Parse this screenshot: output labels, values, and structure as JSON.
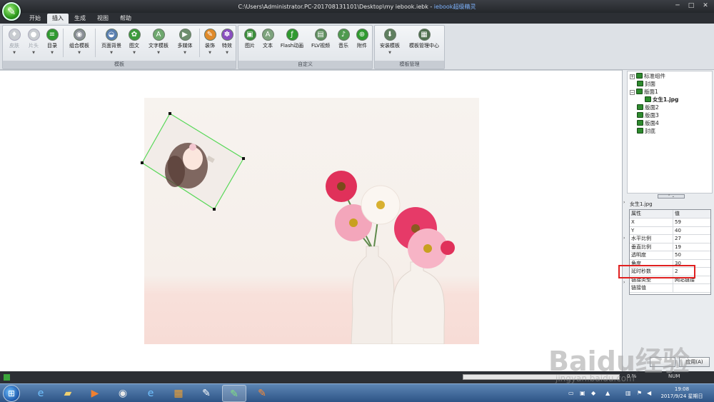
{
  "window": {
    "path": "C:\\Users\\Administrator.PC-201708131101\\Desktop\\my iebook.iebk - ",
    "app_name": "iebook超级精灵",
    "min_icon": "minimize-icon",
    "max_icon": "maximize-icon",
    "close_icon": "close-icon"
  },
  "tabs": [
    "开始",
    "插入",
    "生成",
    "视图",
    "帮助"
  ],
  "active_tab": "插入",
  "ribbon": {
    "groups": [
      {
        "label": "模板",
        "buttons": [
          {
            "label": "皮肤",
            "icon": "skin-icon",
            "enabled": false
          },
          {
            "label": "片头",
            "icon": "intro-icon",
            "enabled": false
          },
          {
            "label": "目录",
            "icon": "catalog-icon",
            "enabled": true
          },
          {
            "label": "组合模板",
            "icon": "combined-template-icon",
            "enabled": true
          },
          {
            "label": "页面背景",
            "icon": "page-background-icon",
            "enabled": true
          },
          {
            "label": "图文",
            "icon": "image-text-icon",
            "enabled": true
          },
          {
            "label": "文字模板",
            "icon": "text-template-icon",
            "enabled": true
          },
          {
            "label": "多媒体",
            "icon": "multimedia-icon",
            "enabled": true
          },
          {
            "label": "装饰",
            "icon": "decoration-icon",
            "enabled": true
          },
          {
            "label": "特效",
            "icon": "effects-icon",
            "enabled": true
          }
        ]
      },
      {
        "label": "自定义",
        "buttons": [
          {
            "label": "图片",
            "icon": "picture-icon",
            "enabled": true
          },
          {
            "label": "文本",
            "icon": "text-icon",
            "enabled": true
          },
          {
            "label": "Flash动画",
            "icon": "flash-icon",
            "enabled": true
          },
          {
            "label": "FLV视频",
            "icon": "flv-video-icon",
            "enabled": true
          },
          {
            "label": "音乐",
            "icon": "music-icon",
            "enabled": true
          },
          {
            "label": "附件",
            "icon": "attachment-icon",
            "enabled": true
          }
        ]
      },
      {
        "label": "模板管理",
        "buttons": [
          {
            "label": "安装模板",
            "icon": "install-template-icon",
            "enabled": true
          },
          {
            "label": "模板管理中心",
            "icon": "template-manager-icon",
            "enabled": true
          }
        ]
      }
    ]
  },
  "tree": [
    {
      "label": "标准组件",
      "level": 0,
      "expander": "+",
      "bold": false
    },
    {
      "label": "封面",
      "level": 0,
      "expander": "",
      "bold": false
    },
    {
      "label": "版面1",
      "level": 0,
      "expander": "−",
      "bold": false
    },
    {
      "label": "女生1.jpg",
      "level": 1,
      "expander": "",
      "bold": true
    },
    {
      "label": "版面2",
      "level": 0,
      "expander": "",
      "bold": false
    },
    {
      "label": "版面3",
      "level": 0,
      "expander": "",
      "bold": false
    },
    {
      "label": "版面4",
      "level": 0,
      "expander": "",
      "bold": false
    },
    {
      "label": "封底",
      "level": 0,
      "expander": "",
      "bold": false
    }
  ],
  "props": {
    "title": "女生1.jpg",
    "header": {
      "key": "属性",
      "value": "值"
    },
    "rows": [
      {
        "key": "X",
        "value": "59"
      },
      {
        "key": "Y",
        "value": "40"
      },
      {
        "key": "水平比例",
        "value": "27"
      },
      {
        "key": "垂直比例",
        "value": "19"
      },
      {
        "key": "透明度",
        "value": "50"
      },
      {
        "key": "角度",
        "value": "30"
      },
      {
        "key": "延时秒数",
        "value": "2"
      },
      {
        "key": "链接类型",
        "value": "网站链接"
      },
      {
        "key": "链接值",
        "value": ""
      }
    ],
    "buttons": [
      "",
      "应用(A)"
    ]
  },
  "statusbar": {
    "zoom": "0 %",
    "num": "NUM"
  },
  "taskbar": {
    "icons": [
      "start-orb-icon",
      "ie-icon",
      "folder-icon",
      "media-player-icon",
      "chrome-icon",
      "ie-icon-2",
      "windows-store-icon",
      "paint-icon",
      "iebook-icon",
      "iebook-reader-icon"
    ],
    "time": "19:08",
    "date": "2017/9/24 星期日"
  },
  "watermark": {
    "big": "Baidu经验",
    "small": "jingyan.baidu.com"
  }
}
